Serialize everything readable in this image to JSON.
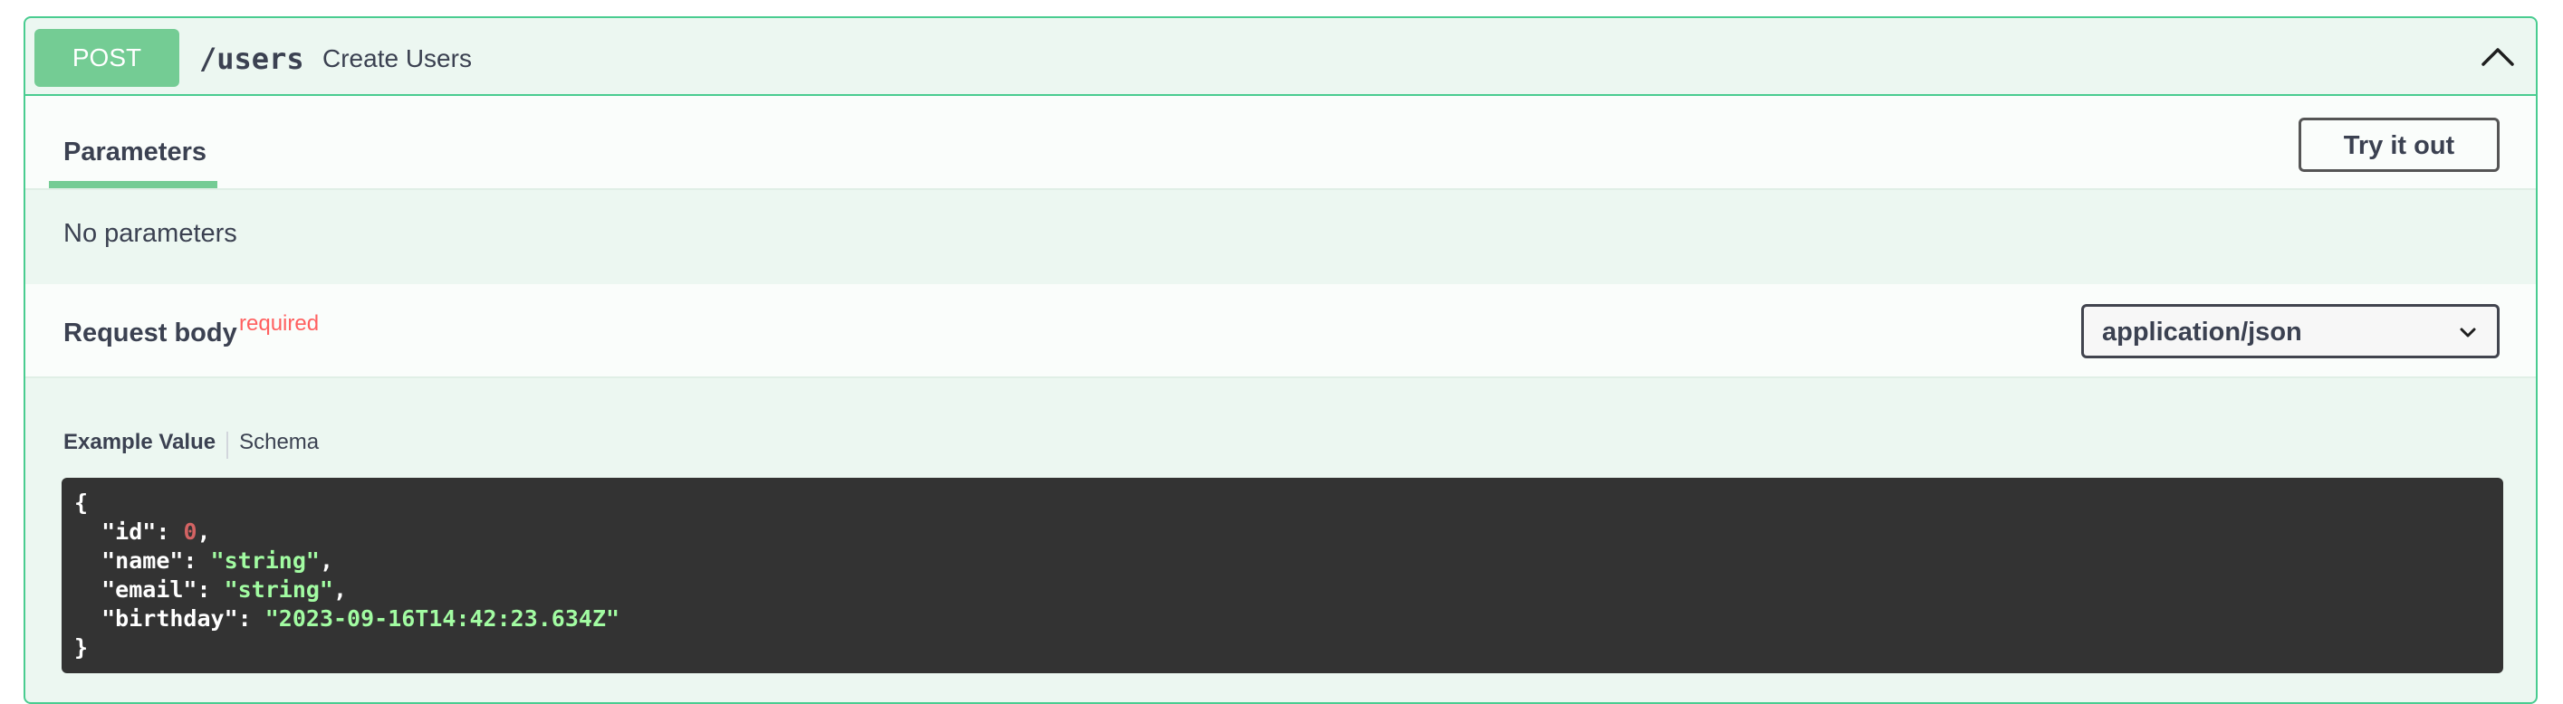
{
  "operation": {
    "method": "POST",
    "path": "/users",
    "summary": "Create Users"
  },
  "tabs": {
    "parameters_label": "Parameters",
    "try_it_out_label": "Try it out"
  },
  "parameters": {
    "empty_text": "No parameters"
  },
  "request_body": {
    "title": "Request body",
    "required_label": "required",
    "content_type": "application/json"
  },
  "model_tabs": {
    "example_value": "Example Value",
    "schema": "Schema"
  },
  "example": {
    "open_brace": "{",
    "close_brace": "}",
    "lines": [
      {
        "key": "\"id\"",
        "sep": ": ",
        "value": "0",
        "type": "num",
        "comma": ","
      },
      {
        "key": "\"name\"",
        "sep": ": ",
        "value": "\"string\"",
        "type": "str",
        "comma": ","
      },
      {
        "key": "\"email\"",
        "sep": ": ",
        "value": "\"string\"",
        "type": "str",
        "comma": ","
      },
      {
        "key": "\"birthday\"",
        "sep": ": ",
        "value": "\"2023-09-16T14:42:23.634Z\"",
        "type": "str",
        "comma": ""
      }
    ]
  },
  "icons": {
    "collapse": "chevron-up-icon",
    "select": "chevron-down-icon"
  },
  "colors": {
    "accent": "#49cc90",
    "method_bg": "#74cc94",
    "required": "#ff6060",
    "code_bg": "#333333",
    "code_string": "#a2fca2",
    "code_number": "#d36363"
  }
}
